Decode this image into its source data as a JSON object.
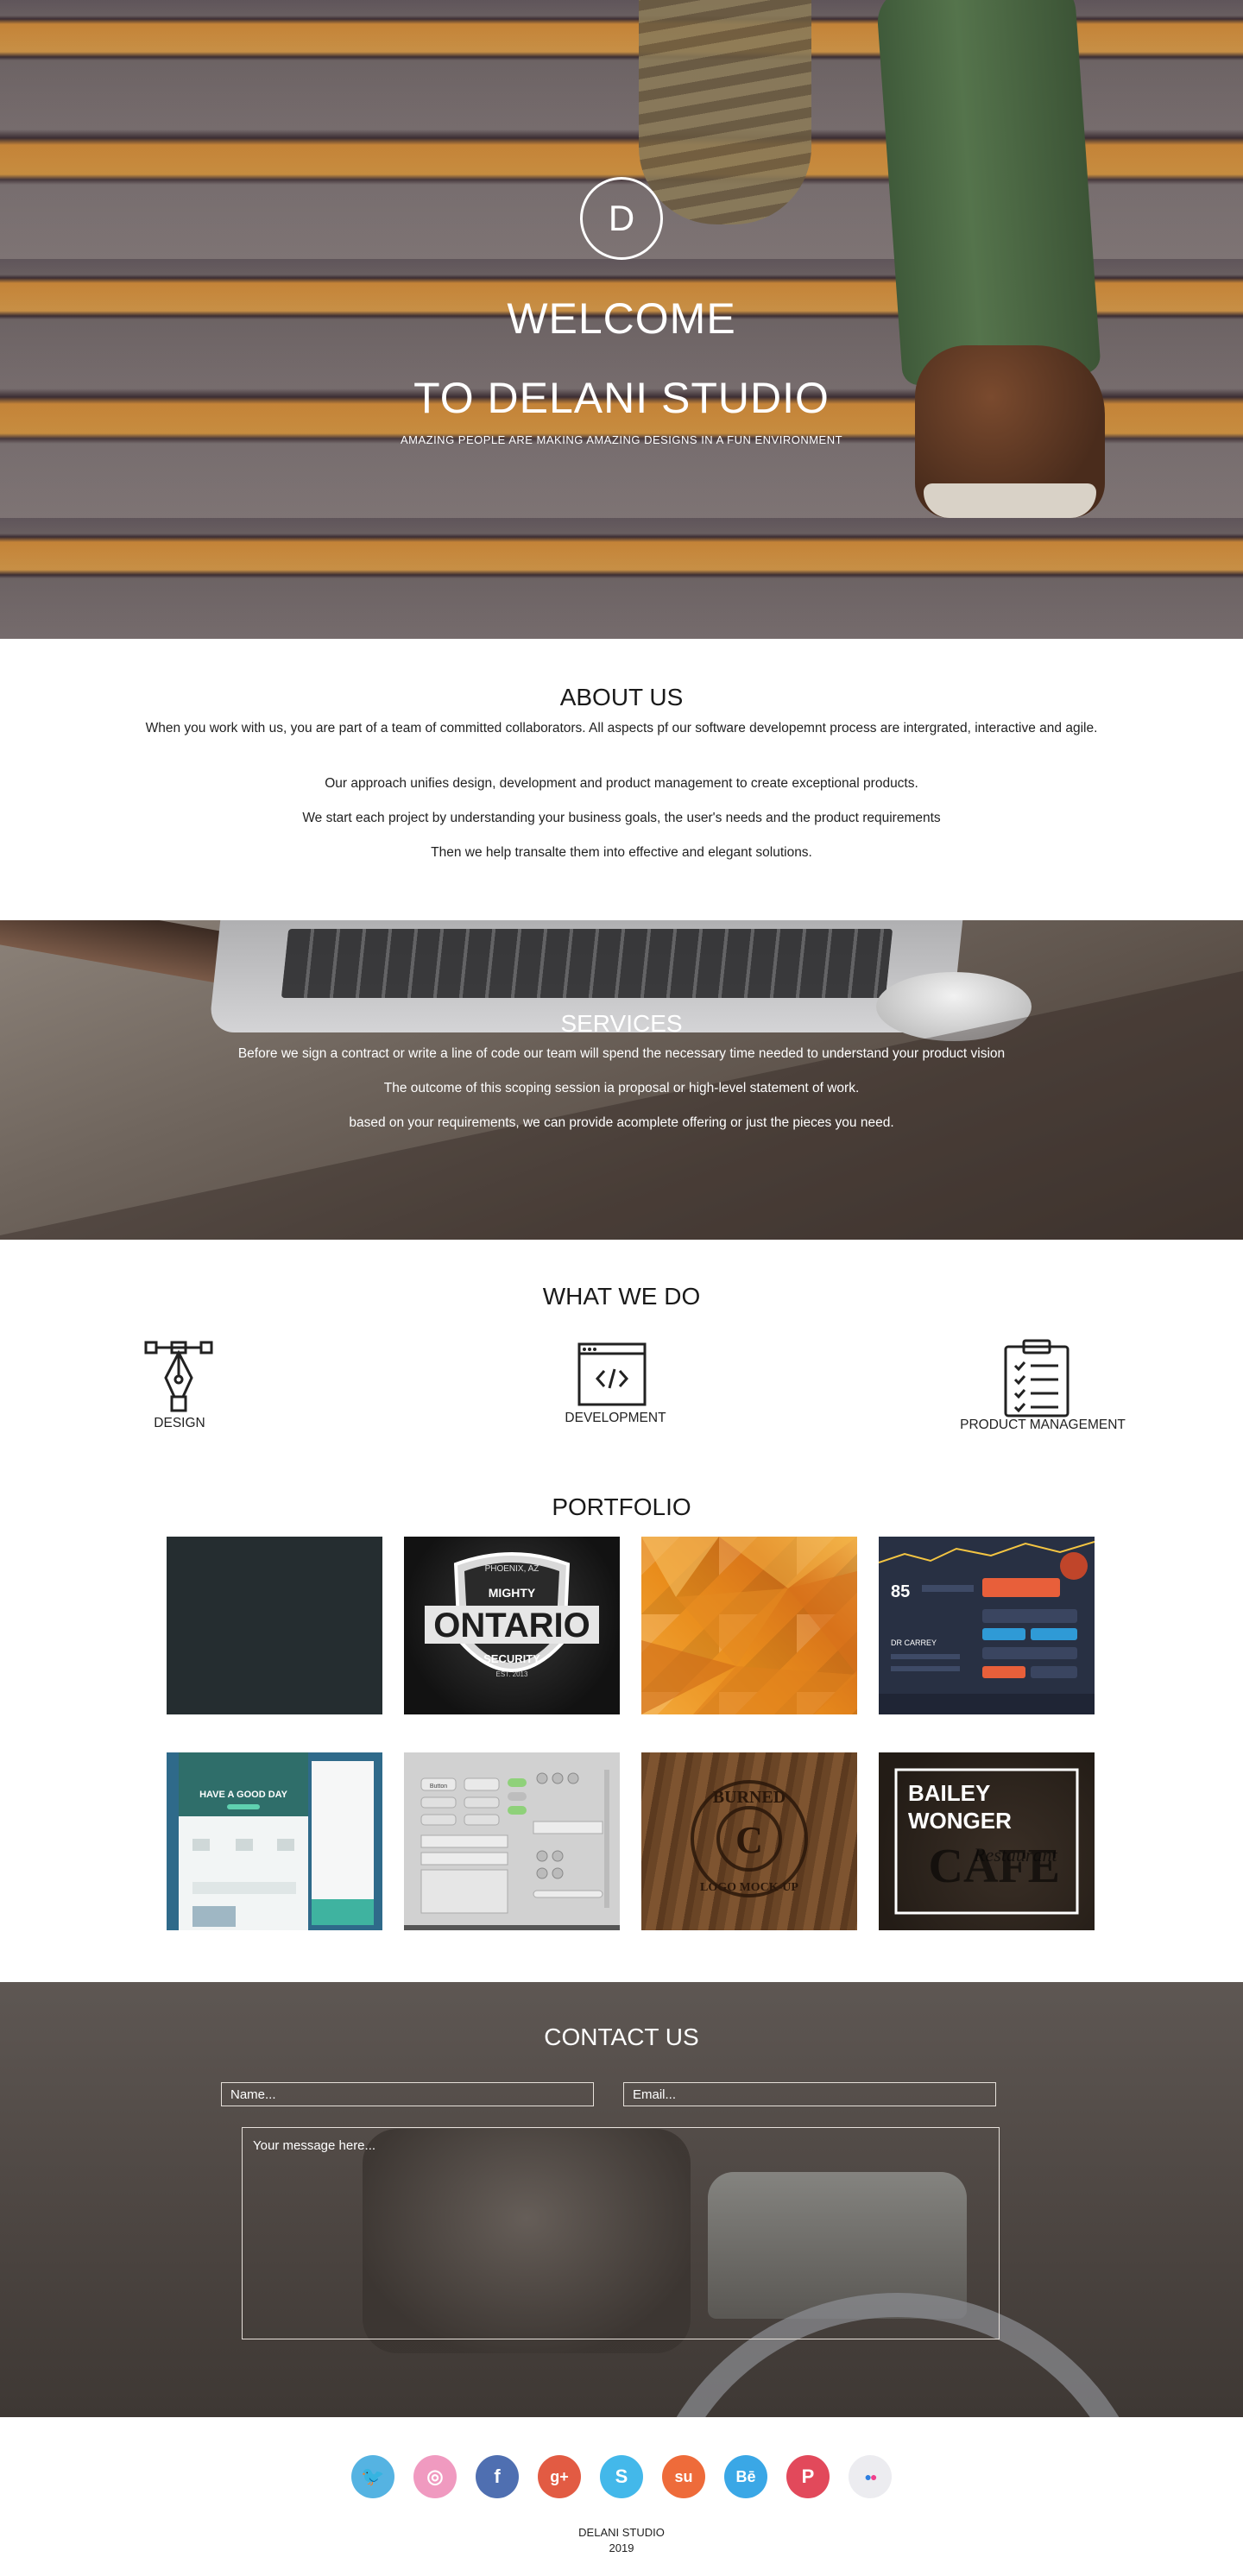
{
  "hero": {
    "logo_letter": "D",
    "title_line1": "WELCOME",
    "title_line2": "TO DELANI STUDIO",
    "subtitle": "AMAZING PEOPLE ARE MAKING AMAZING DESIGNS IN A FUN ENVIRONMENT"
  },
  "about": {
    "title": "ABOUT US",
    "paragraphs": [
      "When you work with us, you are part of a team of committed collaborators. All aspects pf our software developemnt process are intergrated, interactive and agile.",
      "Our approach unifies design, development and product management to create exceptional products.",
      "We start each project by understanding your business goals, the user's needs and the product requirements",
      "Then we help transalte them into effective and elegant solutions."
    ]
  },
  "services": {
    "title": "SERVICES",
    "paragraphs": [
      "Before we sign a contract or write a line of code our team will spend the necessary time needed to understand your product vision",
      "The outcome of this scoping session ia proposal or high-level statement of work.",
      "based on your requirements, we can provide acomplete offering or just the pieces you need."
    ]
  },
  "what_we_do": {
    "title": "WHAT WE DO",
    "items": [
      {
        "label": "DESIGN",
        "icon": "pen-tool-icon"
      },
      {
        "label": "DEVELOPMENT",
        "icon": "code-window-icon"
      },
      {
        "label": "PRODUCT MANAGEMENT",
        "icon": "clipboard-checklist-icon"
      }
    ]
  },
  "portfolio": {
    "title": "PORTFOLIO",
    "tiles": [
      {
        "name": "dark-tile"
      },
      {
        "name": "ontario-badge",
        "small_top": "PHOENIX, AZ",
        "line1": "MIGHTY",
        "line2": "ONTARIO",
        "line3": "SECURITY",
        "line4": "EST. 2013"
      },
      {
        "name": "orange-polygon"
      },
      {
        "name": "dashboard-ui",
        "number": "85",
        "caption": "DR CARREY"
      },
      {
        "name": "website-mockup",
        "headline": "HAVE A GOOD DAY"
      },
      {
        "name": "ui-kit",
        "button_label": "Button"
      },
      {
        "name": "burned-logo",
        "arc_top": "BURNED",
        "center": "C",
        "arc_bottom": "LOGO MOCK-UP"
      },
      {
        "name": "bailey-wonger",
        "line1": "BAILEY",
        "line2": "WONGER",
        "script": "Restaurant",
        "big": "CAFE"
      }
    ]
  },
  "contact": {
    "title": "CONTACT US",
    "name_placeholder": "Name...",
    "email_placeholder": "Email...",
    "message_placeholder": "Your message here..."
  },
  "footer": {
    "social": [
      {
        "icon": "twitter-icon",
        "color": "#55b3e2",
        "glyph": "🐦"
      },
      {
        "icon": "dribbble-icon",
        "color": "#f09ac0",
        "glyph": "◎"
      },
      {
        "icon": "facebook-icon",
        "color": "#4f6fb1",
        "glyph": "f"
      },
      {
        "icon": "google-plus-icon",
        "color": "#e25b43",
        "glyph": "g+"
      },
      {
        "icon": "skype-icon",
        "color": "#43b8ea",
        "glyph": "S"
      },
      {
        "icon": "stumbleupon-icon",
        "color": "#ee6b3a",
        "glyph": "su"
      },
      {
        "icon": "behance-icon",
        "color": "#3aa7e6",
        "glyph": "Bē"
      },
      {
        "icon": "pinterest-icon",
        "color": "#e2495b",
        "glyph": "P"
      },
      {
        "icon": "flickr-icon",
        "color": "#ececf0",
        "glyph": "●●"
      }
    ],
    "name": "DELANI STUDIO",
    "year": "2019"
  }
}
